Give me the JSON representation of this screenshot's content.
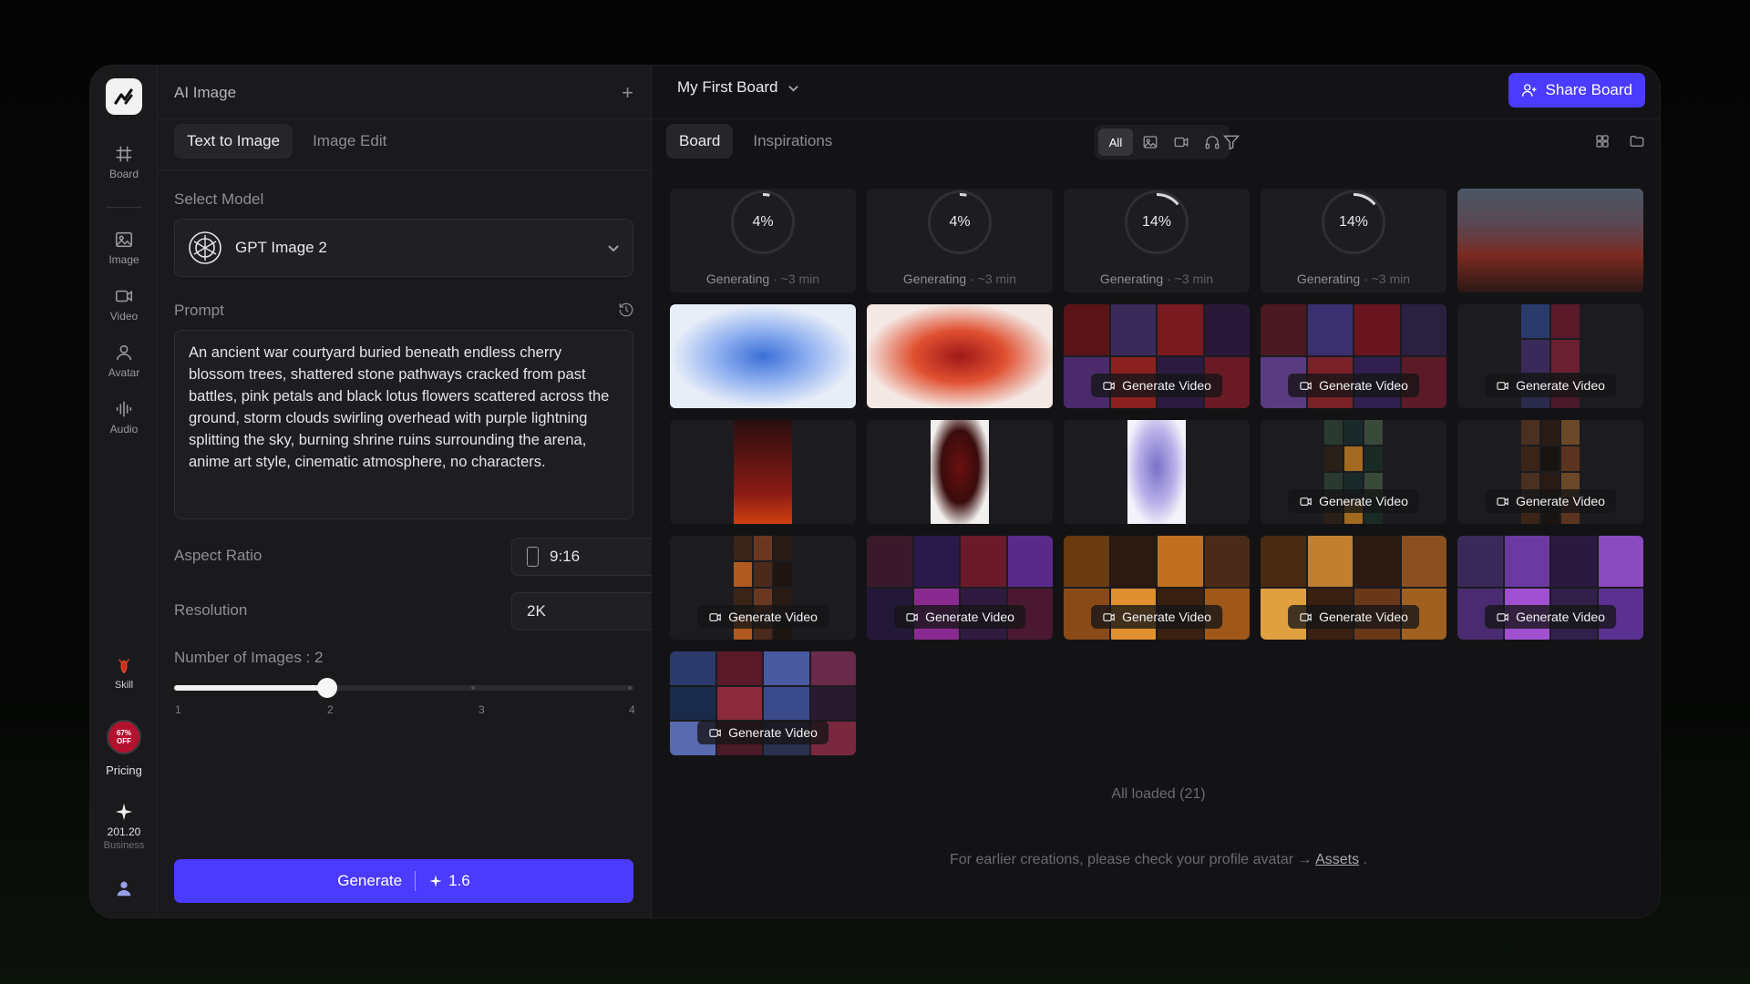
{
  "rail": {
    "items": [
      {
        "label": "Board",
        "icon": "hash-grid-icon"
      },
      {
        "label": "Image",
        "icon": "image-icon"
      },
      {
        "label": "Video",
        "icon": "video-camera-icon"
      },
      {
        "label": "Avatar",
        "icon": "person-icon"
      },
      {
        "label": "Audio",
        "icon": "audio-wave-icon"
      }
    ],
    "skill_label": "Skill",
    "pricing_badge": "67% OFF",
    "pricing_label": "Pricing",
    "credits_value": "201.20",
    "plan_label": "Business"
  },
  "panel": {
    "title": "AI Image",
    "tabs": [
      "Text to Image",
      "Image Edit"
    ],
    "active_tab": "Text to Image",
    "select_model_label": "Select Model",
    "model_name": "GPT Image 2",
    "prompt_label": "Prompt",
    "prompt_text": "An ancient war courtyard buried beneath endless cherry blossom trees, shattered stone pathways cracked from past battles, pink petals and black lotus flowers scattered across the ground, storm clouds swirling overhead with purple lightning splitting the sky, burning shrine ruins surrounding the arena, anime art style, cinematic atmosphere, no characters.",
    "aspect_ratio_label": "Aspect Ratio",
    "aspect_ratio_value": "9:16",
    "resolution_label": "Resolution",
    "resolution_value": "2K",
    "num_images_label": "Number of Images : 2",
    "slider": {
      "min": 1,
      "max": 4,
      "value": 2,
      "ticks": [
        "1",
        "2",
        "3",
        "4"
      ]
    },
    "generate_label": "Generate",
    "generate_cost": "1.6"
  },
  "board": {
    "title": "My First Board",
    "share_label": "Share Board",
    "tabs": [
      "Board",
      "Inspirations"
    ],
    "active_tab": "Board",
    "filter_all_label": "All",
    "generating": [
      {
        "percent": "4%",
        "progress": 0.04,
        "status": "Generating",
        "eta": "· ~3 min"
      },
      {
        "percent": "4%",
        "progress": 0.04,
        "status": "Generating",
        "eta": "· ~3 min"
      },
      {
        "percent": "14%",
        "progress": 0.14,
        "status": "Generating",
        "eta": "· ~3 min"
      },
      {
        "percent": "14%",
        "progress": 0.14,
        "status": "Generating",
        "eta": "· ~3 min"
      }
    ],
    "generate_video_label": "Generate Video",
    "all_loaded": "All loaded  (21)",
    "footer_text": "For earlier creations, please check your profile avatar →",
    "footer_link": "Assets",
    "footer_end": "."
  },
  "colors": {
    "accent": "#4b3bff",
    "panel": "#1a1a1d",
    "background": "#131316"
  }
}
